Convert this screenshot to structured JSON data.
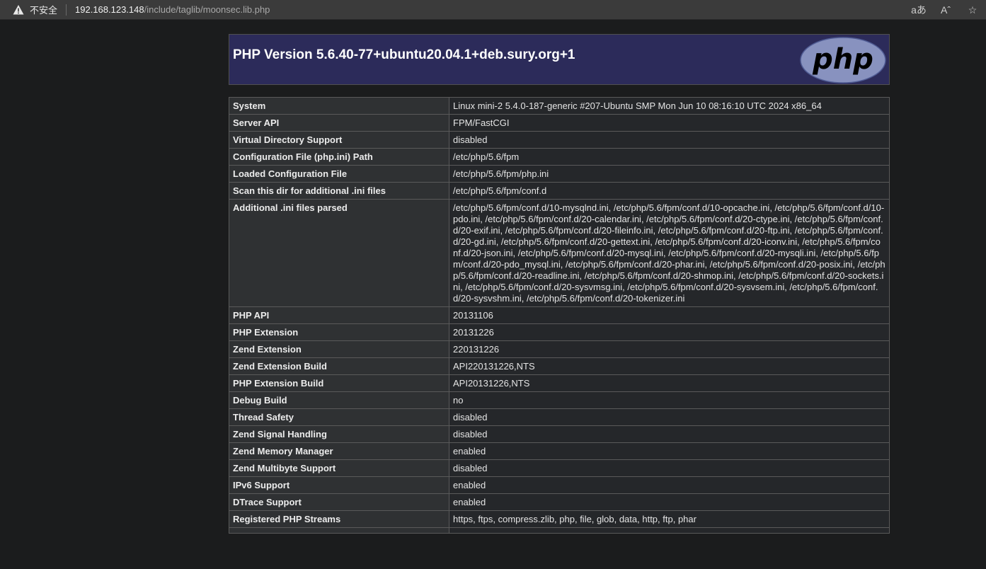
{
  "browser": {
    "security_label": "不安全",
    "url_host": "192.168.123.148",
    "url_path": "/include/taglib/moonsec.lib.php",
    "read_aloud_label": "aあ",
    "text_size_label": "Aˆ",
    "favorite_label": "☆"
  },
  "header": {
    "title": "PHP Version 5.6.40-77+ubuntu20.04.1+deb.sury.org+1",
    "logo_text": "php"
  },
  "rows": [
    {
      "k": "System",
      "v": "Linux mini-2 5.4.0-187-generic #207-Ubuntu SMP Mon Jun 10 08:16:10 UTC 2024 x86_64"
    },
    {
      "k": "Server API",
      "v": "FPM/FastCGI"
    },
    {
      "k": "Virtual Directory Support",
      "v": "disabled"
    },
    {
      "k": "Configuration File (php.ini) Path",
      "v": "/etc/php/5.6/fpm"
    },
    {
      "k": "Loaded Configuration File",
      "v": "/etc/php/5.6/fpm/php.ini"
    },
    {
      "k": "Scan this dir for additional .ini files",
      "v": "/etc/php/5.6/fpm/conf.d"
    },
    {
      "k": "Additional .ini files parsed",
      "v": "/etc/php/5.6/fpm/conf.d/10-mysqlnd.ini, /etc/php/5.6/fpm/conf.d/10-opcache.ini, /etc/php/5.6/fpm/conf.d/10-pdo.ini, /etc/php/5.6/fpm/conf.d/20-calendar.ini, /etc/php/5.6/fpm/conf.d/20-ctype.ini, /etc/php/5.6/fpm/conf.d/20-exif.ini, /etc/php/5.6/fpm/conf.d/20-fileinfo.ini, /etc/php/5.6/fpm/conf.d/20-ftp.ini, /etc/php/5.6/fpm/conf.d/20-gd.ini, /etc/php/5.6/fpm/conf.d/20-gettext.ini, /etc/php/5.6/fpm/conf.d/20-iconv.ini, /etc/php/5.6/fpm/conf.d/20-json.ini, /etc/php/5.6/fpm/conf.d/20-mysql.ini, /etc/php/5.6/fpm/conf.d/20-mysqli.ini, /etc/php/5.6/fpm/conf.d/20-pdo_mysql.ini, /etc/php/5.6/fpm/conf.d/20-phar.ini, /etc/php/5.6/fpm/conf.d/20-posix.ini, /etc/php/5.6/fpm/conf.d/20-readline.ini, /etc/php/5.6/fpm/conf.d/20-shmop.ini, /etc/php/5.6/fpm/conf.d/20-sockets.ini, /etc/php/5.6/fpm/conf.d/20-sysvmsg.ini, /etc/php/5.6/fpm/conf.d/20-sysvsem.ini, /etc/php/5.6/fpm/conf.d/20-sysvshm.ini, /etc/php/5.6/fpm/conf.d/20-tokenizer.ini"
    },
    {
      "k": "PHP API",
      "v": "20131106"
    },
    {
      "k": "PHP Extension",
      "v": "20131226"
    },
    {
      "k": "Zend Extension",
      "v": "220131226"
    },
    {
      "k": "Zend Extension Build",
      "v": "API220131226,NTS"
    },
    {
      "k": "PHP Extension Build",
      "v": "API20131226,NTS"
    },
    {
      "k": "Debug Build",
      "v": "no"
    },
    {
      "k": "Thread Safety",
      "v": "disabled"
    },
    {
      "k": "Zend Signal Handling",
      "v": "disabled"
    },
    {
      "k": "Zend Memory Manager",
      "v": "enabled"
    },
    {
      "k": "Zend Multibyte Support",
      "v": "disabled"
    },
    {
      "k": "IPv6 Support",
      "v": "enabled"
    },
    {
      "k": "DTrace Support",
      "v": "enabled"
    },
    {
      "k": "Registered PHP Streams",
      "v": "https, ftps, compress.zlib, php, file, glob, data, http, ftp, phar"
    },
    {
      "k": "",
      "v": ""
    }
  ]
}
